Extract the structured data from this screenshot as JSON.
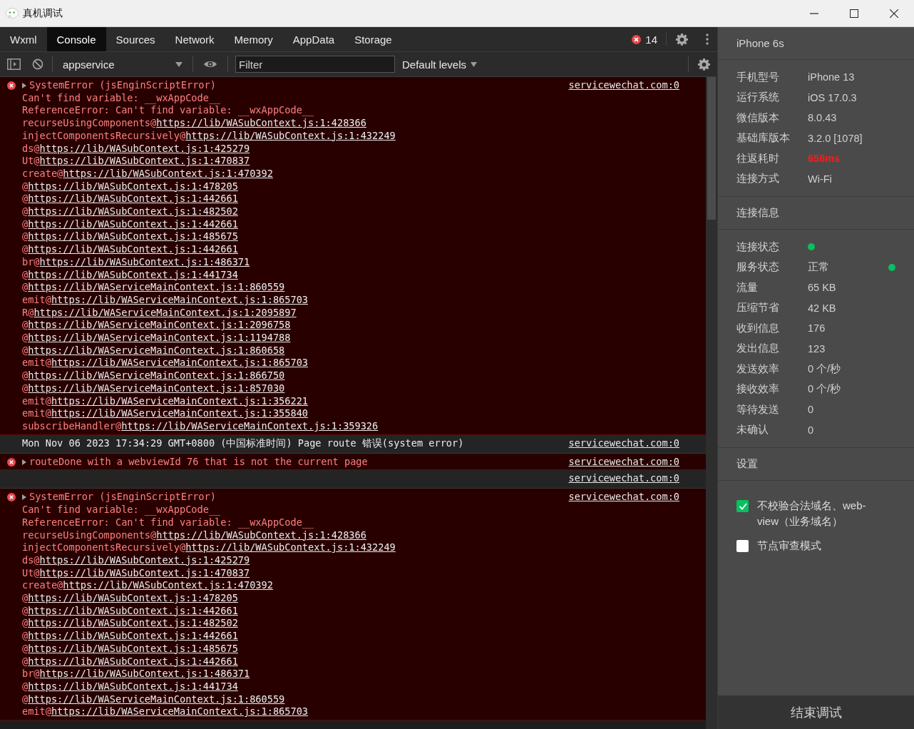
{
  "window": {
    "title": "真机调试"
  },
  "tabs": [
    {
      "label": "Wxml",
      "selected": false
    },
    {
      "label": "Console",
      "selected": true
    },
    {
      "label": "Sources",
      "selected": false
    },
    {
      "label": "Network",
      "selected": false
    },
    {
      "label": "Memory",
      "selected": false
    },
    {
      "label": "AppData",
      "selected": false
    },
    {
      "label": "Storage",
      "selected": false
    }
  ],
  "error_count": "14",
  "toolbar": {
    "context": "appservice",
    "filter": {
      "placeholder": "Filter"
    },
    "levels": "Default levels"
  },
  "console": [
    {
      "kind": "error",
      "expanded": false,
      "title": "SystemError (jsEnginScriptError)",
      "source": "servicewechat.com:0",
      "lines": [
        "Can't find variable: __wxAppCode__",
        "ReferenceError: Can't find variable: __wxAppCode__"
      ],
      "frames": [
        {
          "fn": "recurseUsingComponents@",
          "url": "https://lib/WASubContext.js:1:428366"
        },
        {
          "fn": "injectComponentsRecursively@",
          "url": "https://lib/WASubContext.js:1:432249"
        },
        {
          "fn": "ds@",
          "url": "https://lib/WASubContext.js:1:425279"
        },
        {
          "fn": "Ut@",
          "url": "https://lib/WASubContext.js:1:470837"
        },
        {
          "fn": "create@",
          "url": "https://lib/WASubContext.js:1:470392"
        },
        {
          "fn": "@",
          "url": "https://lib/WASubContext.js:1:478205"
        },
        {
          "fn": "@",
          "url": "https://lib/WASubContext.js:1:442661"
        },
        {
          "fn": "@",
          "url": "https://lib/WASubContext.js:1:482502"
        },
        {
          "fn": "@",
          "url": "https://lib/WASubContext.js:1:442661"
        },
        {
          "fn": "@",
          "url": "https://lib/WASubContext.js:1:485675"
        },
        {
          "fn": "@",
          "url": "https://lib/WASubContext.js:1:442661"
        },
        {
          "fn": "br@",
          "url": "https://lib/WASubContext.js:1:486371"
        },
        {
          "fn": "@",
          "url": "https://lib/WASubContext.js:1:441734"
        },
        {
          "fn": "@",
          "url": "https://lib/WAServiceMainContext.js:1:860559"
        },
        {
          "fn": "emit@",
          "url": "https://lib/WAServiceMainContext.js:1:865703"
        },
        {
          "fn": "R@",
          "url": "https://lib/WAServiceMainContext.js:1:2095897"
        },
        {
          "fn": "@",
          "url": "https://lib/WAServiceMainContext.js:1:2096758"
        },
        {
          "fn": "@",
          "url": "https://lib/WAServiceMainContext.js:1:1194788"
        },
        {
          "fn": "@",
          "url": "https://lib/WAServiceMainContext.js:1:860658"
        },
        {
          "fn": "emit@",
          "url": "https://lib/WAServiceMainContext.js:1:865703"
        },
        {
          "fn": "@",
          "url": "https://lib/WAServiceMainContext.js:1:866750"
        },
        {
          "fn": "@",
          "url": "https://lib/WAServiceMainContext.js:1:857030"
        },
        {
          "fn": "emit@",
          "url": "https://lib/WAServiceMainContext.js:1:356221"
        },
        {
          "fn": "emit@",
          "url": "https://lib/WAServiceMainContext.js:1:355840"
        },
        {
          "fn": "subscribeHandler@",
          "url": "https://lib/WAServiceMainContext.js:1:359326"
        }
      ]
    },
    {
      "kind": "info",
      "text": "Mon Nov 06 2023 17:34:29 GMT+0800 (中国标准时间) Page route 错误(system error)",
      "source": "servicewechat.com:0"
    },
    {
      "kind": "error",
      "expanded": false,
      "title": "routeDone with a webviewId 76 that is not the current page",
      "source": "servicewechat.com:0"
    },
    {
      "kind": "info",
      "source": "servicewechat.com:0"
    },
    {
      "kind": "error",
      "expanded": false,
      "title": "SystemError (jsEnginScriptError)",
      "source": "servicewechat.com:0",
      "lines": [
        "Can't find variable: __wxAppCode__",
        "ReferenceError: Can't find variable: __wxAppCode__"
      ],
      "frames": [
        {
          "fn": "recurseUsingComponents@",
          "url": "https://lib/WASubContext.js:1:428366"
        },
        {
          "fn": "injectComponentsRecursively@",
          "url": "https://lib/WASubContext.js:1:432249"
        },
        {
          "fn": "ds@",
          "url": "https://lib/WASubContext.js:1:425279"
        },
        {
          "fn": "Ut@",
          "url": "https://lib/WASubContext.js:1:470837"
        },
        {
          "fn": "create@",
          "url": "https://lib/WASubContext.js:1:470392"
        },
        {
          "fn": "@",
          "url": "https://lib/WASubContext.js:1:478205"
        },
        {
          "fn": "@",
          "url": "https://lib/WASubContext.js:1:442661"
        },
        {
          "fn": "@",
          "url": "https://lib/WASubContext.js:1:482502"
        },
        {
          "fn": "@",
          "url": "https://lib/WASubContext.js:1:442661"
        },
        {
          "fn": "@",
          "url": "https://lib/WASubContext.js:1:485675"
        },
        {
          "fn": "@",
          "url": "https://lib/WASubContext.js:1:442661"
        },
        {
          "fn": "br@",
          "url": "https://lib/WASubContext.js:1:486371"
        },
        {
          "fn": "@",
          "url": "https://lib/WASubContext.js:1:441734"
        },
        {
          "fn": "@",
          "url": "https://lib/WAServiceMainContext.js:1:860559"
        },
        {
          "fn": "emit@",
          "url": "https://lib/WAServiceMainContext.js:1:865703"
        }
      ]
    }
  ],
  "device": {
    "name": "iPhone 6s",
    "info": [
      {
        "label": "手机型号",
        "value": "iPhone 13",
        "alert": false
      },
      {
        "label": "运行系统",
        "value": "iOS 17.0.3",
        "alert": false
      },
      {
        "label": "微信版本",
        "value": "8.0.43",
        "alert": false
      },
      {
        "label": "基础库版本",
        "value": "3.2.0 [1078]",
        "alert": false
      },
      {
        "label": "往返耗时",
        "value": "658ms",
        "alert": true
      },
      {
        "label": "连接方式",
        "value": "Wi-Fi",
        "alert": false
      }
    ],
    "connection_title": "连接信息",
    "connection": [
      {
        "label": "连接状态",
        "ok": true
      },
      {
        "label": "服务状态",
        "value": "正常",
        "ok": true
      },
      {
        "label": "流量",
        "value": "65 KB"
      },
      {
        "label": "压缩节省",
        "value": "42 KB"
      },
      {
        "label": "收到信息",
        "value": "176"
      },
      {
        "label": "发出信息",
        "value": "123"
      },
      {
        "label": "发送效率",
        "value": "0 个/秒"
      },
      {
        "label": "接收效率",
        "value": "0 个/秒"
      },
      {
        "label": "等待发送",
        "value": "0"
      },
      {
        "label": "未确认",
        "value": "0"
      }
    ],
    "settings_title": "设置",
    "options": [
      {
        "label": "不校验合法域名、web-view（业务域名）",
        "checked": true
      },
      {
        "label": "节点审查模式",
        "checked": false
      }
    ],
    "end_button": "结束调试"
  }
}
